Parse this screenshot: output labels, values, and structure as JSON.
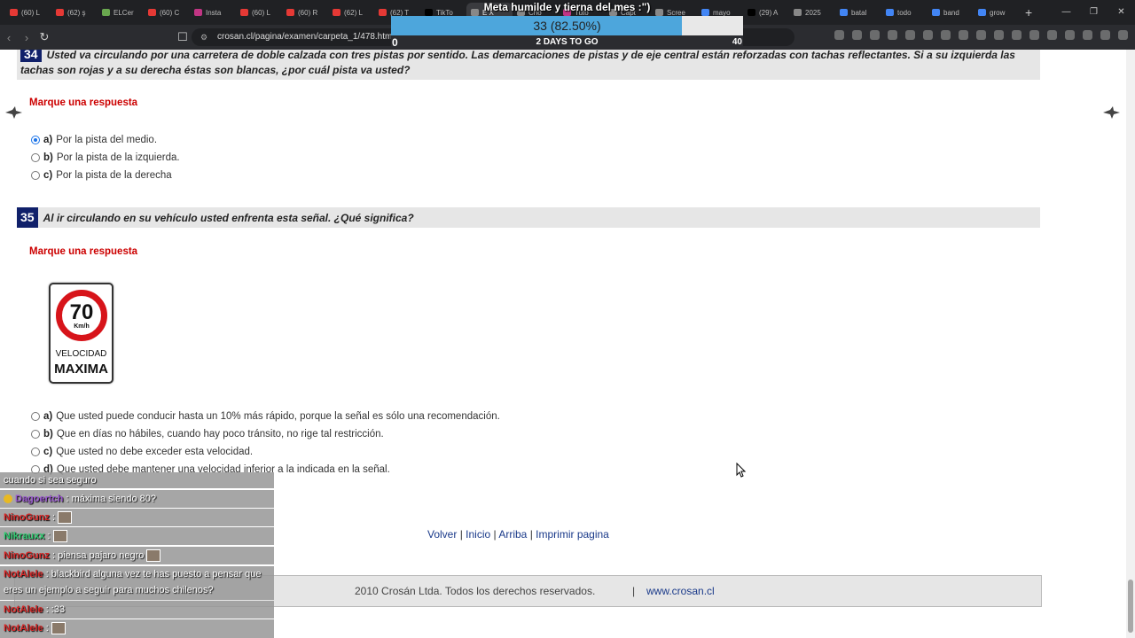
{
  "browser": {
    "tabs": [
      {
        "label": "(60) L",
        "color": "#e53935"
      },
      {
        "label": "(62) ş",
        "color": "#e53935"
      },
      {
        "label": "ELCer",
        "color": "#6aa84f"
      },
      {
        "label": "(60) C",
        "color": "#e53935"
      },
      {
        "label": "Insta",
        "color": "#c13584"
      },
      {
        "label": "(60) L",
        "color": "#e53935"
      },
      {
        "label": "(60) R",
        "color": "#e53935"
      },
      {
        "label": "(62) L",
        "color": "#e53935"
      },
      {
        "label": "(62) T",
        "color": "#e53935"
      },
      {
        "label": "TikTo",
        "color": "#000000"
      },
      {
        "label": "E X",
        "color": "#888888"
      },
      {
        "label": "Cho",
        "color": "#888888"
      },
      {
        "label": "Tuto",
        "color": "#c13584"
      },
      {
        "label": "Capt",
        "color": "#888888"
      },
      {
        "label": "Scree",
        "color": "#888888"
      },
      {
        "label": "mayo",
        "color": "#4285f4"
      },
      {
        "label": "(29) A",
        "color": "#000000"
      },
      {
        "label": "2025",
        "color": "#888888"
      },
      {
        "label": "batal",
        "color": "#4285f4"
      },
      {
        "label": "todo",
        "color": "#4285f4"
      },
      {
        "label": "band",
        "color": "#4285f4"
      },
      {
        "label": "grow",
        "color": "#4285f4"
      }
    ],
    "active_tab_index": 10,
    "url": "crosan.cl/pagina/examen/carpeta_1/478.htm"
  },
  "goal": {
    "title": "Meta humilde y tierna del mes :\")",
    "value_text": "33 (82.50%)",
    "progress": 0.825,
    "start": "0",
    "center": "2 DAYS TO GO",
    "end": "40"
  },
  "q34": {
    "number": "34",
    "text": "Usted va circulando por una carretera de doble calzada con tres pistas por sentido. Las demarcaciones de pistas y de eje central están reforzadas con tachas reflectantes. Si a su izquierda las tachas son rojas y a su derecha éstas son blancas, ¿por cuál pista va usted?",
    "prompt": "Marque una respuesta",
    "options": [
      {
        "letter": "a)",
        "text": "Por la pista del medio.",
        "selected": true
      },
      {
        "letter": "b)",
        "text": "Por la pista de la izquierda.",
        "selected": false
      },
      {
        "letter": "c)",
        "text": "Por la pista de la derecha",
        "selected": false
      }
    ]
  },
  "q35": {
    "number": "35",
    "text": "Al ir circulando en su vehículo usted enfrenta esta señal. ¿Qué significa?",
    "prompt": "Marque una respuesta",
    "sign": {
      "speed": "70",
      "unit": "Km/h",
      "line1": "VELOCIDAD",
      "line2": "MAXIMA"
    },
    "options": [
      {
        "letter": "a)",
        "text": "Que usted puede conducir hasta un 10% más rápido, porque la señal es sólo una recomendación."
      },
      {
        "letter": "b)",
        "text": "Que en días no hábiles, cuando hay poco tránsito, no rige tal restricción."
      },
      {
        "letter": "c)",
        "text": "Que usted no debe exceder esta velocidad."
      },
      {
        "letter": "d)",
        "text": "Que usted debe mantener una velocidad inferior a la indicada en la señal."
      }
    ]
  },
  "footer": {
    "links": [
      "Volver",
      "Inicio",
      "Arriba",
      "Imprimir pagina"
    ],
    "sep": "|",
    "copyright": "2010 Crosán Ltda. Todos los derechos reservados.",
    "site": "www.crosan.cl"
  },
  "chat": [
    {
      "user": "",
      "text": "cuando si sea seguro",
      "color": "#ffffff"
    },
    {
      "user": "Dagoertch",
      "text": ": máxima siendo 80?",
      "color": "#9b59d0"
    },
    {
      "user": "NinoGunz",
      "text": ":",
      "color": "#d62828"
    },
    {
      "user": "Nikrauxx",
      "text": ":",
      "color": "#2ecc71"
    },
    {
      "user": "NinoGunz",
      "text": ": piensa pajaro negro",
      "color": "#d62828"
    },
    {
      "user": "NotAlele",
      "text": ": blackbird alguna vez te has puesto a pensar que eres un ejemplo a seguir para muchos chilenos?",
      "color": "#d62828"
    },
    {
      "user": "NotAlele",
      "text": ": :33",
      "color": "#d62828"
    },
    {
      "user": "NotAlele",
      "text": ":",
      "color": "#d62828"
    }
  ]
}
